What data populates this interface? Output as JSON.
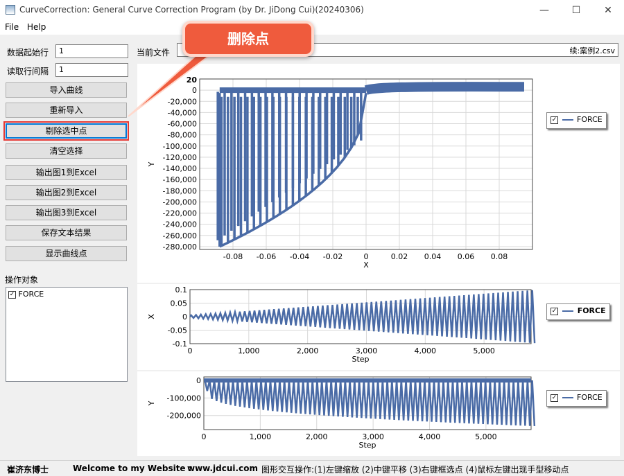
{
  "window": {
    "title": "CurveCorrection: General Curve Correction Program (by Dr. JiDong Cui)(20240306)",
    "minimize": "—",
    "maximize": "☐",
    "close": "✕"
  },
  "menu": [
    "File",
    "Help"
  ],
  "form": {
    "start_row_label": "数据起始行",
    "start_row_value": "1",
    "row_interval_label": "读取行间隔",
    "row_interval_value": "1",
    "current_file_label": "当前文件",
    "current_file_value": "续:案例2.csv"
  },
  "buttons": [
    "导入曲线",
    "重新导入",
    "剔除选中点",
    "清空选择",
    "输出图1到Excel",
    "输出图2到Excel",
    "输出图3到Excel",
    "保存文本结果",
    "显示曲线点"
  ],
  "selected_button_index": 2,
  "objects": {
    "label": "操作对象",
    "items": [
      {
        "label": "FORCE",
        "checked": true
      }
    ]
  },
  "callout": {
    "text": "删除点",
    "color": "#ef5b3d"
  },
  "colors": {
    "series": "#4a6ba6",
    "highlight": "#e53935",
    "plot_bg": "#ffffff",
    "grid": "#d8d8d8"
  },
  "chart_data": [
    {
      "type": "scatter",
      "series": [
        {
          "name": "FORCE"
        }
      ],
      "xlabel": "X",
      "ylabel": "Y",
      "xlim": [
        -0.1,
        0.1
      ],
      "ylim": [
        -285000,
        20000
      ],
      "x_ticks": [
        "-0.08",
        "-0.06",
        "-0.04",
        "-0.02",
        "0",
        "0.02",
        "0.04",
        "0.06",
        "0.08"
      ],
      "y_ticks": [
        "0",
        "-20,000",
        "-40,000",
        "-60,000",
        "-80,000",
        "-100,000",
        "-120,000",
        "-140,000",
        "-160,000",
        "-180,000",
        "-200,000",
        "-220,000",
        "-240,000",
        "-260,000",
        "-280,000"
      ],
      "top_tick_partial": "20",
      "legend": {
        "label": "FORCE",
        "checked": true,
        "position": "right"
      }
    },
    {
      "type": "scatter",
      "series": [
        {
          "name": "FORCE"
        }
      ],
      "xlabel": "Step",
      "ylabel": "X",
      "xlim": [
        0,
        5800
      ],
      "ylim": [
        -0.1,
        0.1
      ],
      "x_ticks": [
        "0",
        "1,000",
        "2,000",
        "3,000",
        "4,000",
        "5,000"
      ],
      "y_ticks": [
        "0.1",
        "0.05",
        "0",
        "-0.05",
        "-0.1"
      ],
      "legend": {
        "label": "FORCE",
        "checked": true,
        "position": "right"
      }
    },
    {
      "type": "scatter",
      "series": [
        {
          "name": "FORCE"
        }
      ],
      "xlabel": "Step",
      "ylabel": "Y",
      "xlim": [
        0,
        5800
      ],
      "ylim": [
        -280000,
        20000
      ],
      "x_ticks": [
        "0",
        "1,000",
        "2,000",
        "3,000",
        "4,000",
        "5,000"
      ],
      "y_ticks": [
        "0",
        "-100,000",
        "-200,000"
      ],
      "legend": {
        "label": "FORCE",
        "checked": true,
        "position": "right"
      }
    }
  ],
  "status": {
    "author": "崔济东博士",
    "welcome": "Welcome to my Website :",
    "site": "www.jdcui.com",
    "hint": "图形交互操作:(1)左键缩放 (2)中键平移 (3)右键框选点 (4)鼠标左键出现手型移动点"
  }
}
